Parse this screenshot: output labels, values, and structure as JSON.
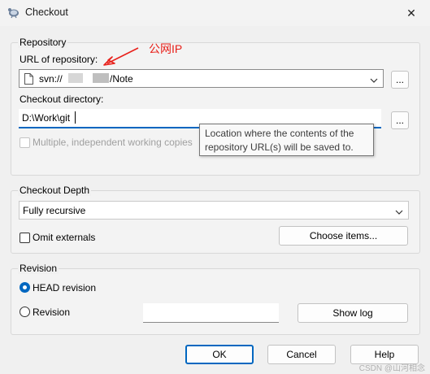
{
  "window": {
    "title": "Checkout",
    "close_glyph": "✕"
  },
  "repository": {
    "group_label": "Repository",
    "url_label": "URL of repository:",
    "annotation": "公网IP",
    "url_value": "svn://",
    "url_suffix": "/Note",
    "browse_glyph": "...",
    "checkout_dir_label": "Checkout directory:",
    "checkout_dir_value": "D:\\Work\\git",
    "multiple_label": "Multiple, independent working copies",
    "tooltip": "Location where the contents of the repository URL(s) will be saved to."
  },
  "depth": {
    "group_label": "Checkout Depth",
    "selected": "Fully recursive",
    "omit_externals_label": "Omit externals",
    "choose_items_label": "Choose items..."
  },
  "revision": {
    "group_label": "Revision",
    "head_label": "HEAD revision",
    "revision_label": "Revision",
    "revision_value": "",
    "show_log_label": "Show log"
  },
  "footer": {
    "ok_label": "OK",
    "cancel_label": "Cancel",
    "help_label": "Help"
  },
  "watermark": "CSDN @山河相念",
  "colors": {
    "accent": "#0067c0",
    "annotation": "#e8201a",
    "focus_border": "#0067c0"
  }
}
